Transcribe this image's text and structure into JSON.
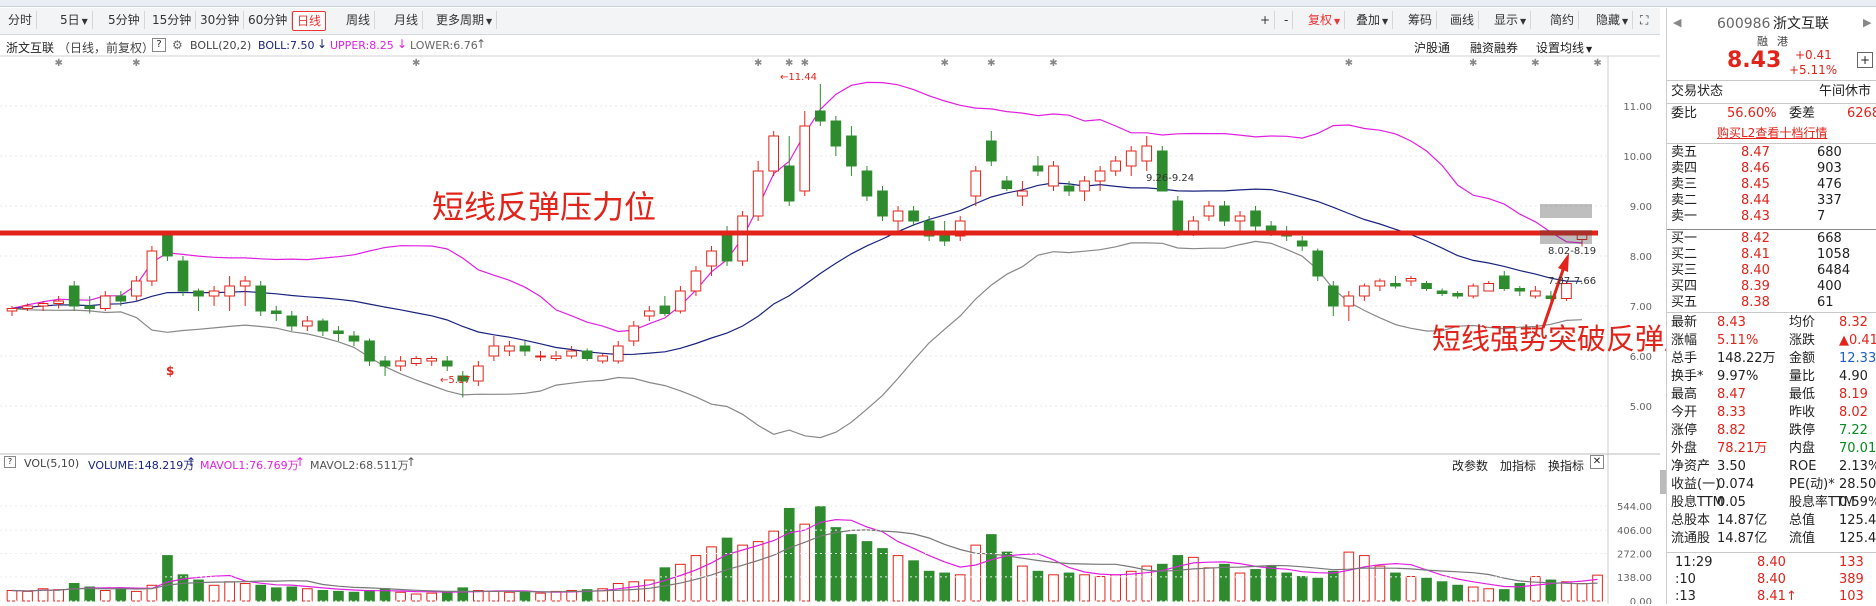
{
  "toolbar": {
    "periods": [
      "分时",
      "5日",
      "5分钟",
      "15分钟",
      "30分钟",
      "60分钟",
      "日线",
      "周线",
      "月线",
      "更多周期"
    ],
    "active_period": "日线",
    "right_tools": [
      "+",
      "-",
      "复权",
      "叠加",
      "筹码",
      "画线",
      "显示",
      "简约",
      "隐藏"
    ]
  },
  "info": {
    "stock_name": "浙文互联",
    "mode": "（日线，前复权）",
    "help": "?",
    "boll_label": "BOLL(20,2)",
    "boll_value": "BOLL:7.50",
    "upper_value": "UPPER:8.25",
    "lower_value": "LOWER:6.76",
    "links": [
      "沪股通",
      "融资融券",
      "设置均线"
    ]
  },
  "price_axis": [
    "11.00",
    "10.00",
    "9.00",
    "8.00",
    "7.00",
    "6.00",
    "5.00"
  ],
  "vol_axis": [
    "544.00",
    "406.00",
    "272.00",
    "138.00",
    "0.00"
  ],
  "chart_labels": {
    "high_label": "11.44",
    "low_label": "5.17",
    "range_label": "9.26-9.24",
    "r1": "8.02-8.19",
    "r2": "7.87-7.66"
  },
  "annotations": {
    "resistance": "短线反弹压力位",
    "breakout": "短线强势突破反弹压力位"
  },
  "vol_info": {
    "label": "VOL(5,10)",
    "volume": "VOLUME:148.219万",
    "mavol1": "MAVOL1:76.769万",
    "mavol2": "MAVOL2:68.511万",
    "links": [
      "改参数",
      "加指标",
      "换指标"
    ]
  },
  "quote": {
    "code": "600986",
    "name": "浙文互联",
    "tags": [
      "融",
      "港"
    ],
    "price": "8.43",
    "change": "+0.41",
    "change_pct": "+5.11%",
    "trade_status_label": "交易状态",
    "trade_status": "午间休市",
    "weibi_label": "委比",
    "weibi": "56.60%",
    "weicha_label": "委差",
    "weicha": "6268",
    "l2_link": "购买L2查看十档行情",
    "asks": [
      {
        "label": "卖五",
        "price": "8.47",
        "vol": "680"
      },
      {
        "label": "卖四",
        "price": "8.46",
        "vol": "903"
      },
      {
        "label": "卖三",
        "price": "8.45",
        "vol": "476"
      },
      {
        "label": "卖二",
        "price": "8.44",
        "vol": "337"
      },
      {
        "label": "卖一",
        "price": "8.43",
        "vol": "7"
      }
    ],
    "bids": [
      {
        "label": "买一",
        "price": "8.42",
        "vol": "668"
      },
      {
        "label": "买二",
        "price": "8.41",
        "vol": "1058"
      },
      {
        "label": "买三",
        "price": "8.40",
        "vol": "6484"
      },
      {
        "label": "买四",
        "price": "8.39",
        "vol": "400"
      },
      {
        "label": "买五",
        "price": "8.38",
        "vol": "61"
      }
    ],
    "stats": [
      {
        "l1": "最新",
        "v1": "8.43",
        "l2": "均价",
        "v2": "8.32"
      },
      {
        "l1": "涨幅",
        "v1": "5.11%",
        "l2": "涨跌",
        "v2": "▲0.41"
      },
      {
        "l1": "总手",
        "v1": "148.22万",
        "l2": "金额",
        "v2": "12.33亿"
      },
      {
        "l1": "换手*",
        "v1": "9.97%",
        "l2": "量比",
        "v2": "4.90"
      },
      {
        "l1": "最高",
        "v1": "8.47",
        "l2": "最低",
        "v2": "8.19"
      },
      {
        "l1": "今开",
        "v1": "8.33",
        "l2": "昨收",
        "v2": "8.02"
      },
      {
        "l1": "涨停",
        "v1": "8.82",
        "l2": "跌停",
        "v2": "7.22"
      },
      {
        "l1": "外盘",
        "v1": "78.21万",
        "l2": "内盘",
        "v2": "70.01万"
      },
      {
        "l1": "净资产",
        "v1": "3.50",
        "l2": "ROE",
        "v2": "2.13%"
      },
      {
        "l1": "收益(一)",
        "v1": "0.074",
        "l2": "PE(动)*",
        "v2": "28.50"
      },
      {
        "l1": "股息TTM",
        "v1": "0.05",
        "l2": "股息率TTM",
        "v2": "0.59%"
      },
      {
        "l1": "总股本",
        "v1": "14.87亿",
        "l2": "总值",
        "v2": "125.4亿"
      },
      {
        "l1": "流通股",
        "v1": "14.87亿",
        "l2": "流值",
        "v2": "125.4亿"
      }
    ],
    "ticks": [
      {
        "time": "11:29",
        "price": "8.40",
        "vol": "133"
      },
      {
        "time": ":10",
        "price": "8.40",
        "vol": "389"
      },
      {
        "time": ":13",
        "price": "8.41↑",
        "vol": "103"
      }
    ]
  },
  "colors": {
    "up": "#e2231a",
    "down": "#2e8b2e",
    "boll_mid": "#1a237e",
    "boll_upper": "#e020e0",
    "boll_lower": "#888888",
    "annotation": "#e2231a"
  },
  "chart_data": {
    "type": "candlestick",
    "ylim": [
      4.4,
      11.6
    ],
    "candles": [
      [
        6.9,
        7.0,
        6.8,
        6.95
      ],
      [
        6.95,
        7.05,
        6.9,
        7.0
      ],
      [
        7.0,
        7.1,
        6.9,
        7.05
      ],
      [
        7.05,
        7.2,
        6.95,
        7.1
      ],
      [
        7.4,
        7.5,
        6.9,
        7.0
      ],
      [
        7.0,
        7.2,
        6.85,
        6.95
      ],
      [
        6.95,
        7.3,
        6.9,
        7.2
      ],
      [
        7.2,
        7.3,
        7.0,
        7.1
      ],
      [
        7.2,
        7.6,
        7.1,
        7.5
      ],
      [
        7.5,
        8.2,
        7.4,
        8.1
      ],
      [
        8.4,
        8.5,
        7.9,
        8.0
      ],
      [
        7.9,
        8.0,
        7.2,
        7.3
      ],
      [
        7.3,
        7.35,
        6.9,
        7.2
      ],
      [
        7.2,
        7.4,
        7.0,
        7.3
      ],
      [
        7.2,
        7.6,
        6.9,
        7.4
      ],
      [
        7.4,
        7.6,
        7.0,
        7.5
      ],
      [
        7.4,
        7.5,
        6.8,
        6.9
      ],
      [
        6.9,
        7.0,
        6.7,
        6.85
      ],
      [
        6.8,
        6.9,
        6.5,
        6.6
      ],
      [
        6.6,
        6.8,
        6.5,
        6.7
      ],
      [
        6.7,
        6.75,
        6.4,
        6.5
      ],
      [
        6.5,
        6.6,
        6.3,
        6.45
      ],
      [
        6.4,
        6.5,
        6.2,
        6.3
      ],
      [
        6.3,
        6.35,
        5.8,
        5.9
      ],
      [
        5.9,
        6.0,
        5.6,
        5.8
      ],
      [
        5.8,
        6.0,
        5.7,
        5.9
      ],
      [
        5.85,
        6.0,
        5.8,
        5.95
      ],
      [
        5.9,
        6.0,
        5.8,
        5.95
      ],
      [
        5.9,
        6.0,
        5.7,
        5.8
      ],
      [
        5.6,
        5.7,
        5.17,
        5.5
      ],
      [
        5.5,
        5.9,
        5.4,
        5.8
      ],
      [
        6.0,
        6.4,
        5.9,
        6.2
      ],
      [
        6.1,
        6.3,
        6.0,
        6.2
      ],
      [
        6.2,
        6.3,
        6.0,
        6.1
      ],
      [
        6.0,
        6.1,
        5.9,
        6.0
      ],
      [
        5.95,
        6.1,
        5.9,
        6.0
      ],
      [
        6.0,
        6.2,
        5.95,
        6.1
      ],
      [
        6.1,
        6.15,
        5.9,
        5.95
      ],
      [
        5.9,
        6.05,
        5.85,
        6.0
      ],
      [
        5.9,
        6.3,
        5.85,
        6.2
      ],
      [
        6.3,
        6.7,
        6.2,
        6.6
      ],
      [
        6.8,
        7.0,
        6.7,
        6.9
      ],
      [
        7.0,
        7.2,
        6.8,
        6.85
      ],
      [
        6.9,
        7.4,
        6.85,
        7.3
      ],
      [
        7.3,
        7.8,
        7.2,
        7.7
      ],
      [
        7.8,
        8.2,
        7.6,
        8.1
      ],
      [
        8.4,
        8.6,
        7.8,
        7.9
      ],
      [
        7.9,
        8.9,
        7.8,
        8.8
      ],
      [
        8.8,
        9.9,
        8.7,
        9.7
      ],
      [
        9.7,
        10.5,
        9.6,
        10.4
      ],
      [
        9.8,
        10.4,
        9.0,
        9.1
      ],
      [
        9.3,
        10.9,
        9.2,
        10.6
      ],
      [
        10.9,
        11.44,
        10.6,
        10.7
      ],
      [
        10.7,
        10.8,
        10.0,
        10.2
      ],
      [
        10.4,
        10.6,
        9.6,
        9.8
      ],
      [
        9.7,
        9.8,
        9.1,
        9.2
      ],
      [
        9.3,
        9.4,
        8.7,
        8.8
      ],
      [
        8.7,
        9.0,
        8.5,
        8.9
      ],
      [
        8.9,
        9.0,
        8.6,
        8.7
      ],
      [
        8.7,
        8.8,
        8.3,
        8.4
      ],
      [
        8.5,
        8.7,
        8.2,
        8.3
      ],
      [
        8.4,
        8.8,
        8.3,
        8.7
      ],
      [
        9.2,
        9.8,
        9.0,
        9.7
      ],
      [
        10.3,
        10.5,
        9.8,
        9.9
      ],
      [
        9.5,
        9.6,
        9.3,
        9.35
      ],
      [
        9.2,
        9.5,
        9.0,
        9.3
      ],
      [
        9.8,
        10.0,
        9.6,
        9.7
      ],
      [
        9.4,
        9.9,
        9.3,
        9.8
      ],
      [
        9.4,
        9.5,
        9.2,
        9.3
      ],
      [
        9.3,
        9.6,
        9.1,
        9.5
      ],
      [
        9.5,
        9.8,
        9.3,
        9.7
      ],
      [
        9.7,
        10.0,
        9.6,
        9.9
      ],
      [
        9.8,
        10.2,
        9.6,
        10.1
      ],
      [
        9.9,
        10.4,
        9.7,
        10.2
      ],
      [
        10.1,
        10.2,
        9.3,
        9.3
      ],
      [
        9.1,
        9.2,
        8.4,
        8.5
      ],
      [
        8.5,
        8.8,
        8.4,
        8.7
      ],
      [
        8.8,
        9.1,
        8.7,
        9.0
      ],
      [
        9.0,
        9.1,
        8.6,
        8.7
      ],
      [
        8.7,
        8.9,
        8.5,
        8.8
      ],
      [
        8.9,
        9.0,
        8.5,
        8.6
      ],
      [
        8.6,
        8.7,
        8.4,
        8.5
      ],
      [
        8.5,
        8.6,
        8.3,
        8.4
      ],
      [
        8.3,
        8.4,
        8.1,
        8.2
      ],
      [
        8.1,
        8.15,
        7.5,
        7.6
      ],
      [
        7.4,
        7.5,
        6.8,
        7.0
      ],
      [
        7.0,
        7.3,
        6.7,
        7.2
      ],
      [
        7.2,
        7.45,
        7.1,
        7.4
      ],
      [
        7.4,
        7.55,
        7.3,
        7.5
      ],
      [
        7.45,
        7.6,
        7.35,
        7.4
      ],
      [
        7.5,
        7.6,
        7.4,
        7.55
      ],
      [
        7.45,
        7.5,
        7.3,
        7.35
      ],
      [
        7.3,
        7.35,
        7.2,
        7.25
      ],
      [
        7.25,
        7.3,
        7.15,
        7.2
      ],
      [
        7.2,
        7.45,
        7.15,
        7.4
      ],
      [
        7.3,
        7.5,
        7.3,
        7.45
      ],
      [
        7.6,
        7.7,
        7.3,
        7.35
      ],
      [
        7.35,
        7.4,
        7.2,
        7.3
      ],
      [
        7.2,
        7.4,
        7.15,
        7.3
      ],
      [
        7.2,
        7.3,
        7.1,
        7.15
      ],
      [
        7.15,
        7.5,
        7.1,
        7.45
      ],
      [
        8.33,
        8.47,
        8.19,
        8.43
      ]
    ],
    "volumes": [
      60,
      55,
      70,
      65,
      100,
      80,
      60,
      75,
      55,
      90,
      260,
      150,
      120,
      90,
      110,
      100,
      90,
      75,
      80,
      70,
      60,
      55,
      50,
      60,
      70,
      50,
      40,
      45,
      50,
      75,
      60,
      55,
      50,
      50,
      45,
      55,
      60,
      65,
      70,
      100,
      110,
      120,
      190,
      210,
      260,
      310,
      360,
      320,
      340,
      400,
      530,
      440,
      540,
      420,
      380,
      340,
      300,
      260,
      230,
      170,
      160,
      150,
      320,
      380,
      280,
      200,
      170,
      150,
      160,
      150,
      140,
      150,
      170,
      200,
      210,
      260,
      250,
      190,
      210,
      160,
      180,
      200,
      160,
      140,
      130,
      170,
      280,
      260,
      200,
      160,
      140,
      130,
      110,
      90,
      80,
      70,
      65,
      100,
      140,
      120,
      110,
      100,
      148
    ]
  }
}
